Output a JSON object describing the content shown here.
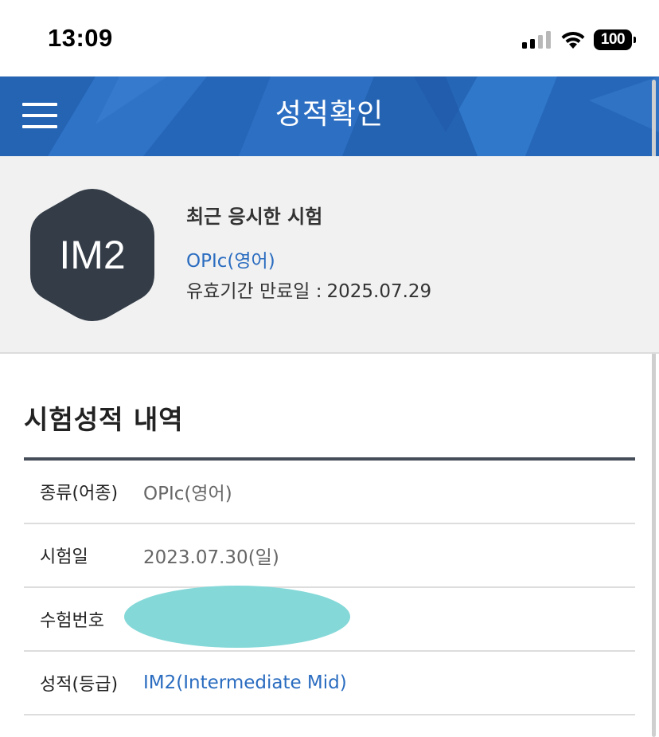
{
  "status_bar": {
    "time": "13:09",
    "battery": "100",
    "icons": [
      "signal-icon",
      "wifi-icon",
      "battery-icon"
    ]
  },
  "header": {
    "title": "성적확인",
    "menu_icon": "hamburger-menu-icon",
    "background_color": "#2a6cc0"
  },
  "summary": {
    "grade": "IM2",
    "recent_label": "최근 응시한 시험",
    "exam_name": "OPIc(영어)",
    "expiry_label": "유효기간 만료일 :",
    "expiry_date": "2025.07.29"
  },
  "results": {
    "title": "시험성적 내역",
    "rows": [
      {
        "label": "종류(어종)",
        "value": "OPIc(영어)"
      },
      {
        "label": "시험일",
        "value": "2023.07.30(일)"
      },
      {
        "label": "수험번호",
        "value": ""
      },
      {
        "label": "성적(등급)",
        "value": "IM2(Intermediate Mid)"
      }
    ]
  },
  "colors": {
    "accent": "#2a6cc0",
    "hex_badge": "#333c47",
    "redaction": "#85d8d8"
  }
}
